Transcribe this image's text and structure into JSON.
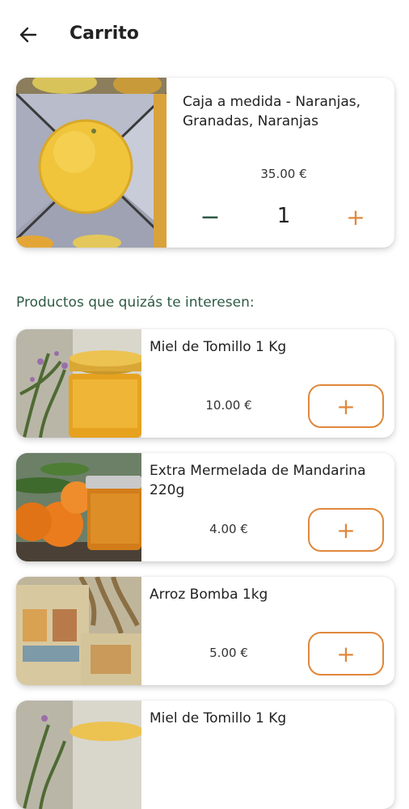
{
  "header": {
    "title": "Carrito",
    "back_icon": "arrow-left-icon"
  },
  "cart": {
    "item": {
      "name": "Caja a medida - Naranjas, Granadas, Naranjas",
      "price": "35.00 €",
      "quantity": "1",
      "minus_symbol": "−",
      "plus_symbol": "+"
    }
  },
  "suggestions": {
    "title": "Productos que quizás te interesen:",
    "add_symbol": "+",
    "items": [
      {
        "name": "Miel de Tomillo 1 Kg",
        "price": "10.00 €"
      },
      {
        "name": "Extra Mermelada de Mandarina 220g",
        "price": "4.00 €"
      },
      {
        "name": "Arroz Bomba 1kg",
        "price": "5.00 €"
      },
      {
        "name": "Miel de Tomillo 1 Kg",
        "price": ""
      }
    ]
  },
  "colors": {
    "accent": "#e0873b",
    "green": "#2f5b45"
  }
}
